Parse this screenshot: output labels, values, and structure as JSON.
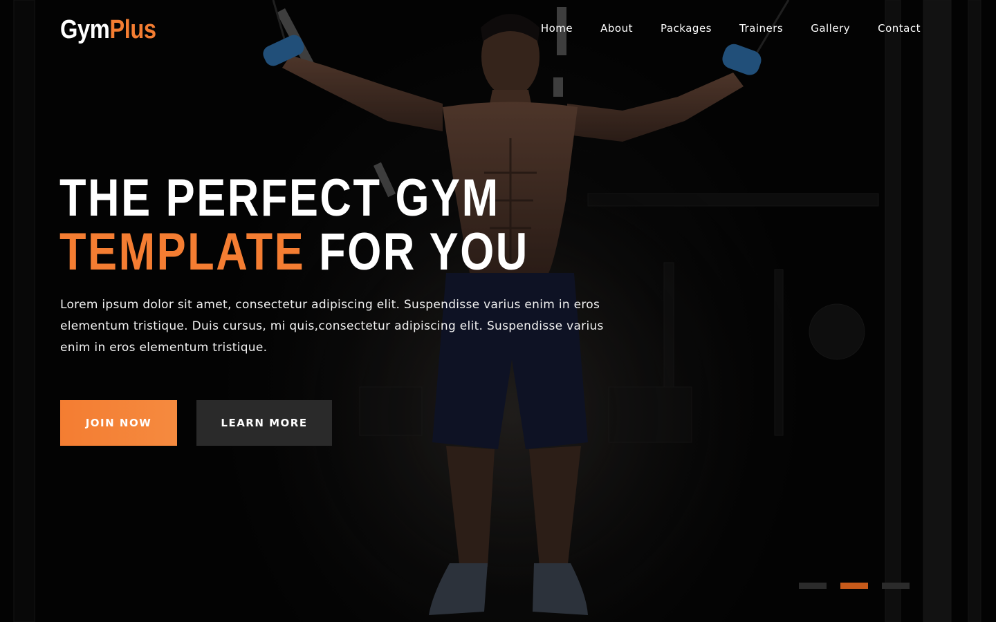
{
  "brand": {
    "name_part1": "Gym",
    "name_part2": "Plus"
  },
  "nav": {
    "items": [
      {
        "label": "Home"
      },
      {
        "label": "About"
      },
      {
        "label": "Packages"
      },
      {
        "label": "Trainers"
      },
      {
        "label": "Gallery"
      },
      {
        "label": "Contact"
      }
    ]
  },
  "hero": {
    "headline_line1": "THE PERFECT GYM",
    "headline_accent": "TEMPLATE",
    "headline_rest": " FOR YOU",
    "lead": "Lorem ipsum dolor sit amet, consectetur adipiscing elit. Suspendisse varius enim in eros elementum tristique. Duis cursus, mi quis,consectetur adipiscing elit. Suspendisse varius enim in eros elementum tristique.",
    "join_label": "JOIN NOW",
    "learn_label": "LEARN MORE",
    "slides": {
      "count": 3,
      "active": 2
    }
  },
  "colors": {
    "accent": "#f47d32",
    "background": "#050505",
    "secondary_button": "#2a2a2a"
  },
  "icons": [
    "slider-dot"
  ]
}
